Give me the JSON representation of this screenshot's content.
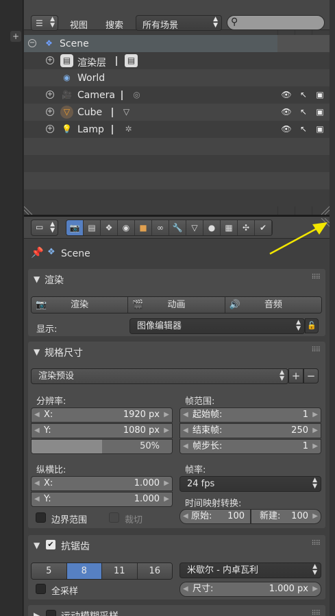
{
  "outliner": {
    "header": {
      "menu_view": "视图",
      "menu_search": "搜索",
      "display_mode": "所有场景",
      "search_placeholder": ""
    },
    "rows": [
      {
        "label": "Scene"
      },
      {
        "label": "渲染层"
      },
      {
        "label": "World"
      },
      {
        "label": "Camera"
      },
      {
        "label": "Cube"
      },
      {
        "label": "Lamp"
      }
    ]
  },
  "properties": {
    "context_tabs": [
      "render",
      "render-layers",
      "scene",
      "world",
      "object",
      "constraints",
      "modifiers",
      "data",
      "material",
      "texture",
      "particles",
      "physics"
    ],
    "active_tab": "render",
    "breadcrumb": "Scene",
    "render_panel": {
      "title": "渲染",
      "buttons": [
        "渲染",
        "动画",
        "音频"
      ],
      "display_label": "显示:",
      "display_value": "图像编辑器"
    },
    "dimensions_panel": {
      "title": "规格尺寸",
      "preset": "渲染预设",
      "resolution_label": "分辨率:",
      "res_x_label": "X:",
      "res_x": "1920 px",
      "res_y_label": "Y:",
      "res_y": "1080 px",
      "res_percent": "50%",
      "res_percent_value": 0.5,
      "frame_range_label": "帧范围:",
      "start_label": "起始帧:",
      "start": "1",
      "end_label": "结束帧:",
      "end": "250",
      "step_label": "帧步长:",
      "step": "1",
      "aspect_label": "纵横比:",
      "aspect_x_label": "X:",
      "aspect_x": "1.000",
      "aspect_y_label": "Y:",
      "aspect_y": "1.000",
      "frame_rate_label": "帧率:",
      "frame_rate": "24 fps",
      "time_remap_label": "时间映射转换:",
      "old_label": "原始:",
      "old": "100",
      "new_label": "新建:",
      "new": "100",
      "border_label": "边界范围",
      "crop_label": "裁切"
    },
    "antialias_panel": {
      "title": "抗锯齿",
      "samples": [
        "5",
        "8",
        "11",
        "16"
      ],
      "selected_sample": "8",
      "filter": "米歇尔 - 内卓瓦利",
      "full_sample_label": "全采样",
      "size_label": "尺寸:",
      "size": "1.000 px"
    },
    "motion_blur_panel": {
      "title": "运动模糊采样"
    }
  },
  "colors": {
    "accent": "#5680c2",
    "annotation_arrow": "#f2e600"
  }
}
